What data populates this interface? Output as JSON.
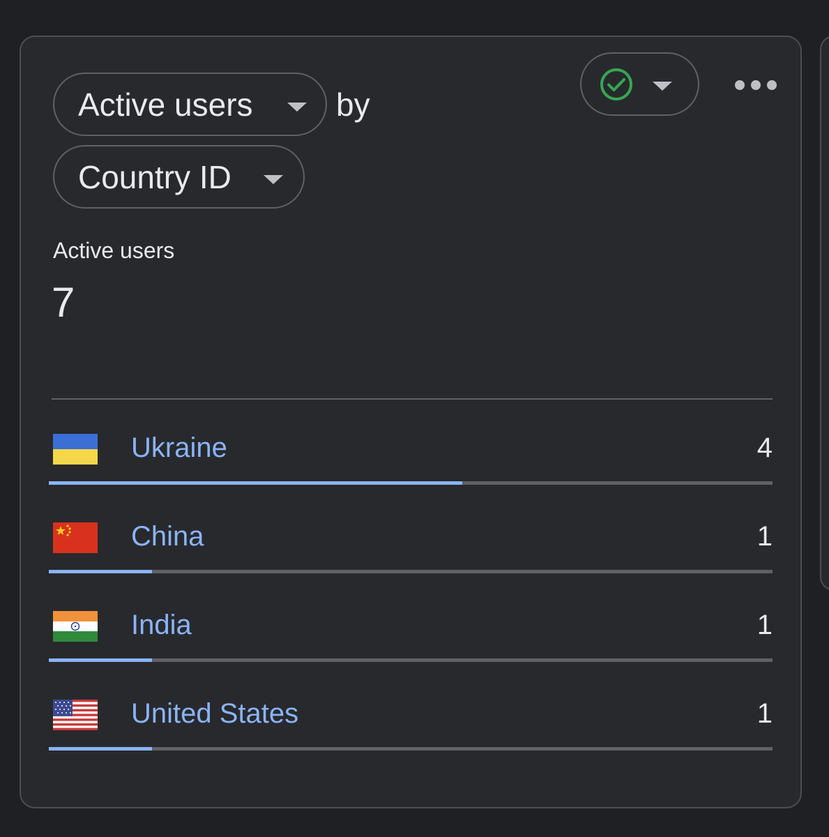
{
  "card": {
    "metric_selector": "Active users",
    "by_text": "by",
    "dimension_selector": "Country ID",
    "status_icon": "check-circle-icon",
    "menu_icon": "more-horiz-icon"
  },
  "summary": {
    "title": "Active users",
    "value": "7"
  },
  "colors": {
    "accent": "#8ab4f8",
    "status_ok": "#34a853",
    "track": "#5f6165",
    "card_bg": "#28292d"
  },
  "rows": [
    {
      "flag": "flag-ukraine-icon",
      "country": "Ukraine",
      "count": "4",
      "share": 0.5714
    },
    {
      "flag": "flag-china-icon",
      "country": "China",
      "count": "1",
      "share": 0.1429
    },
    {
      "flag": "flag-india-icon",
      "country": "India",
      "count": "1",
      "share": 0.1429
    },
    {
      "flag": "flag-united-states-icon",
      "country": "United States",
      "count": "1",
      "share": 0.1429
    }
  ]
}
